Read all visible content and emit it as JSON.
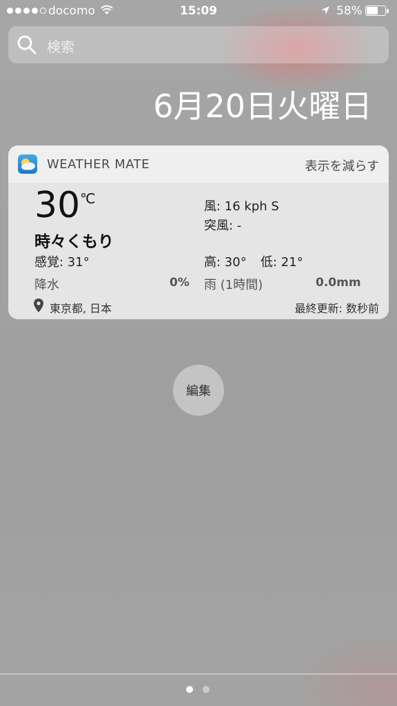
{
  "status_bar": {
    "carrier": "docomo",
    "time": "15:09",
    "battery_percent": "58%",
    "battery_level": 0.58,
    "signal_bars_filled": 4,
    "signal_bars_total": 5
  },
  "search": {
    "placeholder": "検索"
  },
  "date": "6月20日火曜日",
  "widget": {
    "app_name": "WEATHER MATE",
    "show_less_label": "表示を減らす",
    "temperature": "30",
    "temperature_unit": "℃",
    "condition": "時々くもり",
    "feels_like": "感覚: 31°",
    "precipitation_label": "降水",
    "precipitation_value": "0%",
    "wind": "風: 16 kph S",
    "gust": "突風: -",
    "high": "高: 30°",
    "low": "低: 21°",
    "rain_label": "雨 (1時間)",
    "rain_value": "0.0mm",
    "location": "東京都, 日本",
    "last_updated": "最終更新: 数秒前"
  },
  "edit_button_label": "編集",
  "page_indicator": {
    "pages": 2,
    "active_index": 0
  },
  "colors": {
    "background": "#9c9c9c",
    "text_primary": "#111111",
    "text_secondary": "#555555",
    "app_icon": "#1d78c8"
  }
}
